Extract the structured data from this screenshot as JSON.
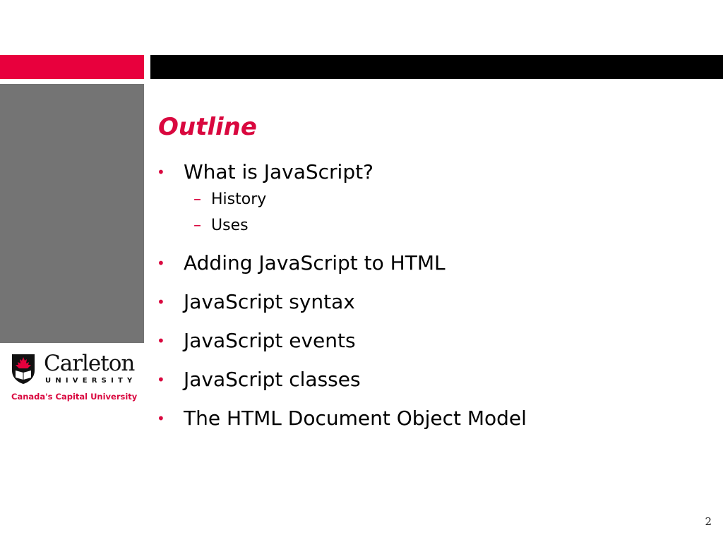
{
  "slide": {
    "title": "Outline",
    "page_number": "2",
    "colors": {
      "accent": "#d9083f",
      "header_red": "#e8003d",
      "header_black": "#000000",
      "panel_gray": "#747474"
    }
  },
  "outline": {
    "bullet_glyph": "•",
    "dash_glyph": "–",
    "items": [
      {
        "label": "What is JavaScript?",
        "subitems": [
          "History",
          "Uses"
        ]
      },
      {
        "label": "Adding JavaScript to HTML"
      },
      {
        "label": "JavaScript syntax"
      },
      {
        "label": "JavaScript events"
      },
      {
        "label": "JavaScript classes"
      },
      {
        "label": "The HTML Document Object Model"
      }
    ]
  },
  "logo": {
    "name": "Carleton",
    "subtitle": "UNIVERSITY",
    "tagline": "Canada's Capital University",
    "icon": "shield-maple-leaf-book-icon"
  }
}
